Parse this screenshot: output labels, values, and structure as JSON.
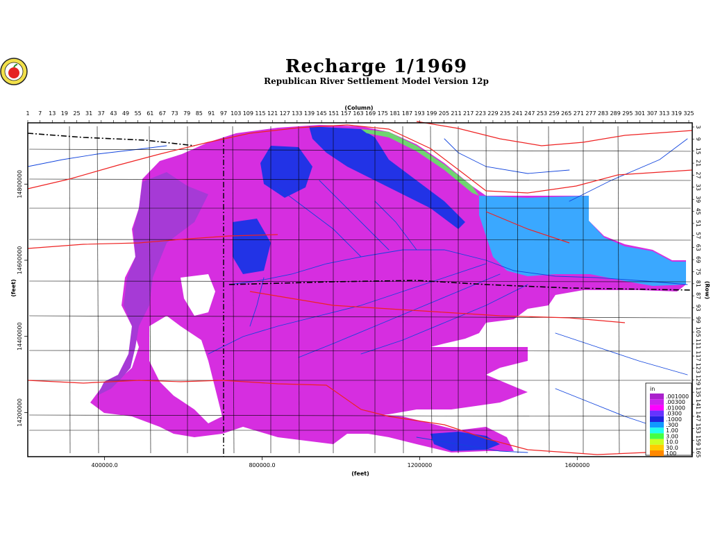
{
  "title": "Recharge  1/1969",
  "subtitle": "Republican River Settlement Model Version 12p",
  "logo_icon": "apple-logo-icon",
  "col_axis": {
    "label": "(Column)",
    "ticks": [
      "1",
      "7",
      "13",
      "19",
      "25",
      "31",
      "37",
      "43",
      "49",
      "55",
      "61",
      "67",
      "73",
      "79",
      "85",
      "91",
      "97",
      "103",
      "109",
      "115",
      "121",
      "127",
      "133",
      "139",
      "145",
      "151",
      "157",
      "163",
      "169",
      "175",
      "181",
      "187",
      "193",
      "199",
      "205",
      "211",
      "217",
      "223",
      "229",
      "235",
      "241",
      "247",
      "253",
      "259",
      "265",
      "271",
      "277",
      "283",
      "289",
      "295",
      "301",
      "307",
      "313",
      "319",
      "325"
    ]
  },
  "row_axis": {
    "label": "(Row)",
    "ticks": [
      "3",
      "9",
      "15",
      "21",
      "27",
      "33",
      "39",
      "45",
      "51",
      "57",
      "63",
      "69",
      "75",
      "81",
      "87",
      "93",
      "99",
      "105",
      "111",
      "117",
      "123",
      "129",
      "135",
      "141",
      "147",
      "153",
      "159",
      "165"
    ]
  },
  "x_axis": {
    "label": "(feet)",
    "ticks": [
      {
        "value": 400000,
        "label": "400000.0"
      },
      {
        "value": 800000,
        "label": "800000.0"
      },
      {
        "value": 1200000,
        "label": "1200000"
      },
      {
        "value": 1600000,
        "label": "1600000"
      }
    ],
    "range": [
      205000,
      1892000
    ]
  },
  "y_axis": {
    "label": "(feet)",
    "ticks": [
      {
        "value": 14800000,
        "label": "14800000"
      },
      {
        "value": 14600000,
        "label": "14600000"
      },
      {
        "value": 14400000,
        "label": "14400000"
      },
      {
        "value": 14200000,
        "label": "14200000"
      }
    ],
    "range": [
      14084000,
      14961000
    ]
  },
  "legend": {
    "unit": "in",
    "entries": [
      {
        "label": ".001000",
        "color": "#aa22cc"
      },
      {
        "label": ".00300",
        "color": "#cc22ee"
      },
      {
        "label": ".01000",
        "color": "#ff00ff"
      },
      {
        "label": ".0300",
        "color": "#6633ff"
      },
      {
        "label": ".1000",
        "color": "#2222dd"
      },
      {
        "label": ".300",
        "color": "#1199ff"
      },
      {
        "label": "1.00",
        "color": "#22ffee"
      },
      {
        "label": "3.00",
        "color": "#44ff44"
      },
      {
        "label": "10.0",
        "color": "#ccff22"
      },
      {
        "label": "30.0",
        "color": "#ffcc00"
      },
      {
        "label": "100",
        "color": "#ff8800"
      }
    ]
  },
  "colors": {
    "frame": "#000000",
    "roads": "#ee2222",
    "rivers": "#1144dd",
    "county_lines": "#000000",
    "base_fill": "#d62ee0",
    "dark_purple": "#a63ad6",
    "light_blue": "#3aa8ff",
    "blue": "#2233e6"
  }
}
